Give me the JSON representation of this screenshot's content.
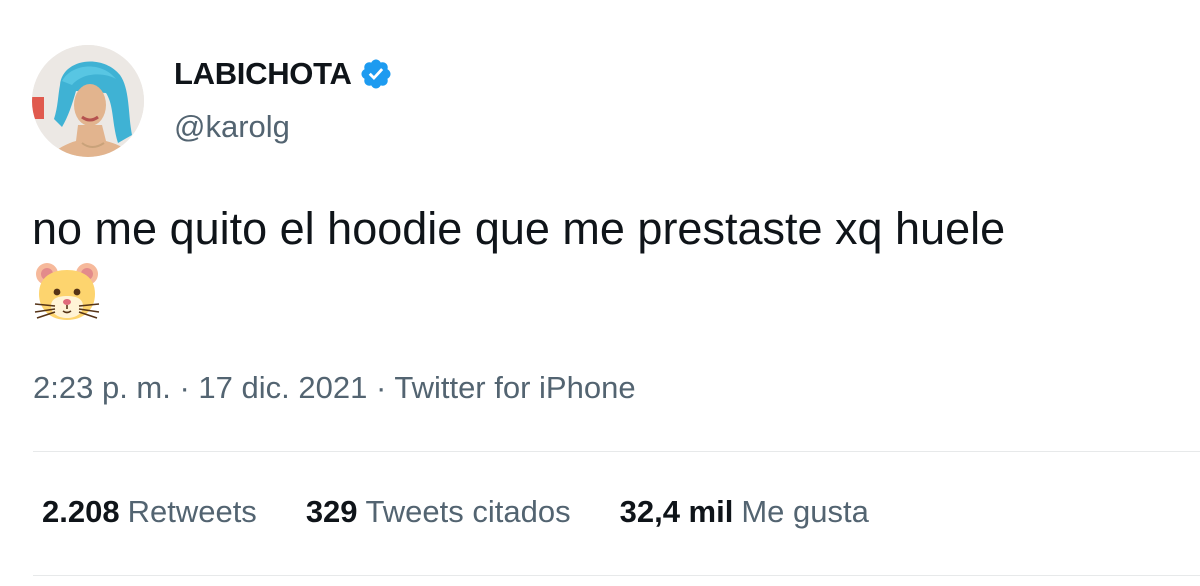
{
  "user": {
    "display_name": "LABICHOTA",
    "handle": "@karolg",
    "verified_icon": "verified-badge-icon",
    "avatar_icon": "profile-photo"
  },
  "tweet": {
    "text": "no me quito el hoodie que me prestaste xq huele",
    "emoji": "hamster-face-emoji"
  },
  "meta": {
    "time": "2:23 p. m.",
    "separator": " · ",
    "date": "17 dic. 2021",
    "source": "Twitter for iPhone"
  },
  "stats": [
    {
      "count": "2.208",
      "label": "Retweets"
    },
    {
      "count": "329",
      "label": "Tweets citados"
    },
    {
      "count": "32,4 mil",
      "label": "Me gusta"
    }
  ],
  "colors": {
    "text": "#0f1419",
    "secondary": "#536471",
    "verified": "#1d9bf0",
    "divider": "#e7e9ea"
  }
}
